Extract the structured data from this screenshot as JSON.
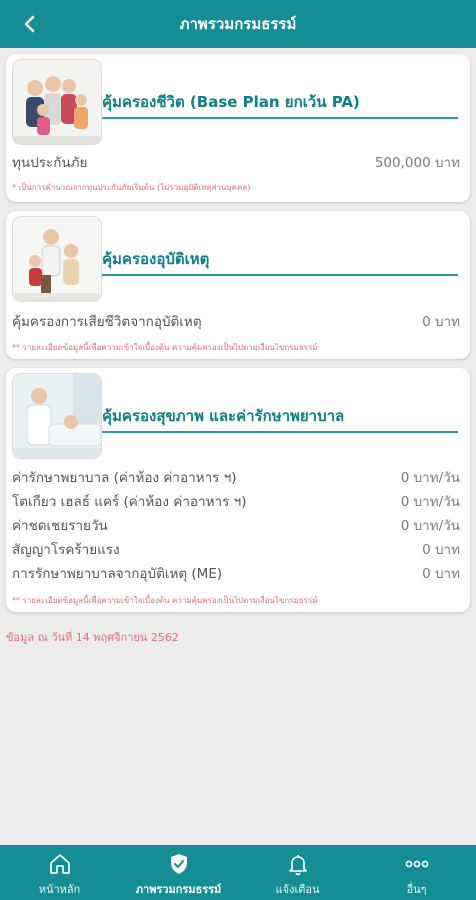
{
  "header": {
    "title": "ภาพรวมกรมธรรม์",
    "back_icon": "chevron-left-icon"
  },
  "cards": [
    {
      "title": "คุ้มครองชีวิต (Base Plan ยกเว้น PA)",
      "image": "family-photo",
      "rows": [
        {
          "label": "ทุนประกันภัย",
          "value": "500,000 บาท"
        }
      ],
      "note": "* เป็นการคำนวณจากทุนประกันภัยเริ่มต้น (ไม่รวมอุบัติเหตุส่วนบุคคล)"
    },
    {
      "title": "คุ้มครองอุบัติเหตุ",
      "image": "family-outdoor-photo",
      "rows": [
        {
          "label": "คุ้มครองการเสียชีวิตจากอุบัติเหตุ",
          "value": "0 บาท"
        }
      ],
      "note": "** รายละเอียดข้อมูลนี้เพื่อความเข้าใจเบื้องต้น ความคุ้มครองเป็นไปตามเงื่อนไขกรมธรรม์"
    },
    {
      "title": "คุ้มครองสุขภาพ และค่ารักษาพยาบาล",
      "image": "doctor-patient-photo",
      "rows": [
        {
          "label": "ค่ารักษาพยาบาล (ค่าห้อง ค่าอาหาร ฯ)",
          "value": "0 บาท/วัน"
        },
        {
          "label": "โตเกียว เฮลธ์ แคร์ (ค่าห้อง ค่าอาหาร ฯ)",
          "value": "0 บาท/วัน"
        },
        {
          "label": "ค่าชดเชยรายวัน",
          "value": "0 บาท/วัน"
        },
        {
          "label": "สัญญาโรคร้ายแรง",
          "value": "0 บาท"
        },
        {
          "label": "การรักษาพยาบาลจากอุบัติเหตุ (ME)",
          "value": "0 บาท"
        }
      ],
      "note": "** รายละเอียดข้อมูลนี้เพื่อความเข้าใจเบื้องต้น ความคุ้มครองเป็นไปตามเงื่อนไขกรมธรรม์"
    }
  ],
  "data_date": "ข้อมูล ณ วันที่ 14 พฤศจิกายน 2562",
  "bottom_nav": [
    {
      "label": "หน้าหลัก",
      "icon": "home-icon",
      "active": false
    },
    {
      "label": "ภาพรวมกรมธรรม์",
      "icon": "shield-check-icon",
      "active": true
    },
    {
      "label": "แจ้งเตือน",
      "icon": "bell-icon",
      "active": false
    },
    {
      "label": "อื่นๆ",
      "icon": "more-dots-icon",
      "active": false
    }
  ],
  "colors": {
    "primary": "#148d95",
    "title_text": "#0f7e86",
    "note_text": "#e26f7a",
    "background": "#ececec"
  }
}
